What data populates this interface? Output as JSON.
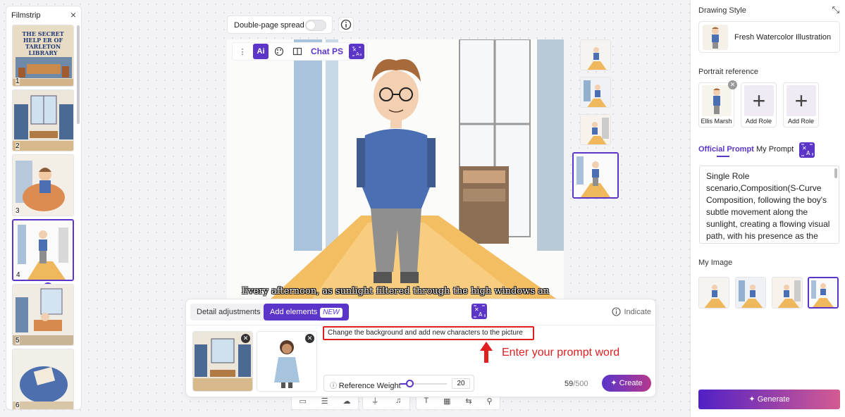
{
  "filmstrip": {
    "title": "Filmstrip",
    "close_icon": "×",
    "pages": [
      {
        "num": "1",
        "cover_text": "THE SECRET HELP ER OF TARLETON LIBRARY"
      },
      {
        "num": "2"
      },
      {
        "num": "3"
      },
      {
        "num": "4"
      },
      {
        "num": "5"
      },
      {
        "num": "6"
      }
    ],
    "add_page_icon": "+"
  },
  "canvas": {
    "spread_label": "Double-page spread",
    "spread_enabled": false,
    "toolbar": {
      "ai_label": "Ai",
      "chat_label": "Chat PS"
    },
    "caption": "Every afternoon, as sunlight filtered through the high windows an"
  },
  "edit_panel": {
    "tab_detail": "Detail adjustments",
    "tab_add": "Add elements",
    "tab_add_badge": "NEW",
    "indicate_label": "Indicate",
    "prompt_value": "Change the background and add new characters to the picture",
    "hint": "Enter your prompt word",
    "ref_weight_label": "Reference Weight",
    "ref_weight_value": "20",
    "ref_weight_fraction": 0.2,
    "char_count": "59",
    "char_max": "/500",
    "create_label": "Create"
  },
  "right_panel": {
    "drawing_style_title": "Drawing Style",
    "style_name": "Fresh Watercolor Illustration",
    "portrait_title": "Portrait reference",
    "roles": [
      {
        "name": "Ellis Marsh"
      },
      {
        "name": "Add Role"
      },
      {
        "name": "Add Role"
      }
    ],
    "tab_official": "Official Prompt",
    "tab_my": "My Prompt",
    "prompt_text": "Single Role scenario,Composition(S-Curve Composition, following the boy's subtle movement along the sunlight, creating a flowing visual path, with his presence as the main focus point)",
    "my_image_title": "My Image",
    "generate_label": "Generate"
  },
  "colors": {
    "accent": "#5b35c8",
    "hint_red": "#e02020"
  }
}
